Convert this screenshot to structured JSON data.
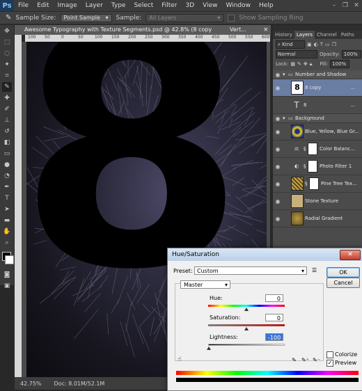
{
  "menubar": {
    "logo": "Ps",
    "items": [
      "File",
      "Edit",
      "Image",
      "Layer",
      "Type",
      "Select",
      "Filter",
      "3D",
      "View",
      "Window",
      "Help"
    ],
    "window_controls": [
      "–",
      "❐",
      "✕"
    ]
  },
  "options_bar": {
    "sample_size_label": "Sample Size:",
    "sample_size_value": "Point Sample",
    "sample_label": "Sample:",
    "sample_value": "All Layers",
    "show_ring_label": "Show Sampling Ring"
  },
  "document": {
    "tab_title": "Awesome Typography with Texture Segments.psd @ 42.8% (8 copy",
    "tab_suffix": "Vert...",
    "ruler_ticks": [
      "100",
      "50",
      "0",
      "50",
      "100",
      "150",
      "200",
      "250",
      "300",
      "350",
      "400",
      "450",
      "500",
      "550",
      "600"
    ],
    "artwork_text": "8",
    "zoom": "42.75%",
    "doc_size": "Doc: 8.01M/52.1M"
  },
  "panels": {
    "tabs": [
      "History",
      "Layers",
      "Channel",
      "Paths"
    ],
    "active_tab": "Layers",
    "kind_label": "Kind",
    "blend_mode": "Normal",
    "opacity_label": "Opacity:",
    "opacity_value": "100%",
    "lock_label": "Lock:",
    "fill_label": "Fill:",
    "fill_value": "100%",
    "layers": [
      {
        "name": "Number and Shadow",
        "type": "group"
      },
      {
        "name": "8 copy",
        "type": "text-raster",
        "selected": true,
        "thumb_label": "8",
        "extra": "..."
      },
      {
        "name": "8",
        "type": "text",
        "thumb_label": "T",
        "extra": "..."
      },
      {
        "name": "Background",
        "type": "group"
      },
      {
        "name": "Blue, Yellow, Blue Gr...",
        "type": "gradient"
      },
      {
        "name": "Color Balanc...",
        "type": "adjustment",
        "thumb_label": "⚖"
      },
      {
        "name": "Photo Filter 1",
        "type": "adjustment",
        "thumb_label": "◐"
      },
      {
        "name": "Pine Tree Tex...",
        "type": "image"
      },
      {
        "name": "Stone Texture",
        "type": "image"
      },
      {
        "name": "Radial Gradient",
        "type": "gradient"
      }
    ]
  },
  "dialog": {
    "title": "Hue/Saturation",
    "close": "✕",
    "preset_label": "Preset:",
    "preset_value": "Custom",
    "channel_value": "Master",
    "hue_label": "Hue:",
    "hue_value": "0",
    "saturation_label": "Saturation:",
    "saturation_value": "0",
    "lightness_label": "Lightness:",
    "lightness_value": "-100",
    "ok_label": "OK",
    "cancel_label": "Cancel",
    "colorize_label": "Colorize",
    "preview_label": "Preview",
    "preview_checked": true,
    "colorize_checked": false
  },
  "colors": {
    "selected_layer": "#6a7da3",
    "ui_dark": "#4b4b4b"
  }
}
